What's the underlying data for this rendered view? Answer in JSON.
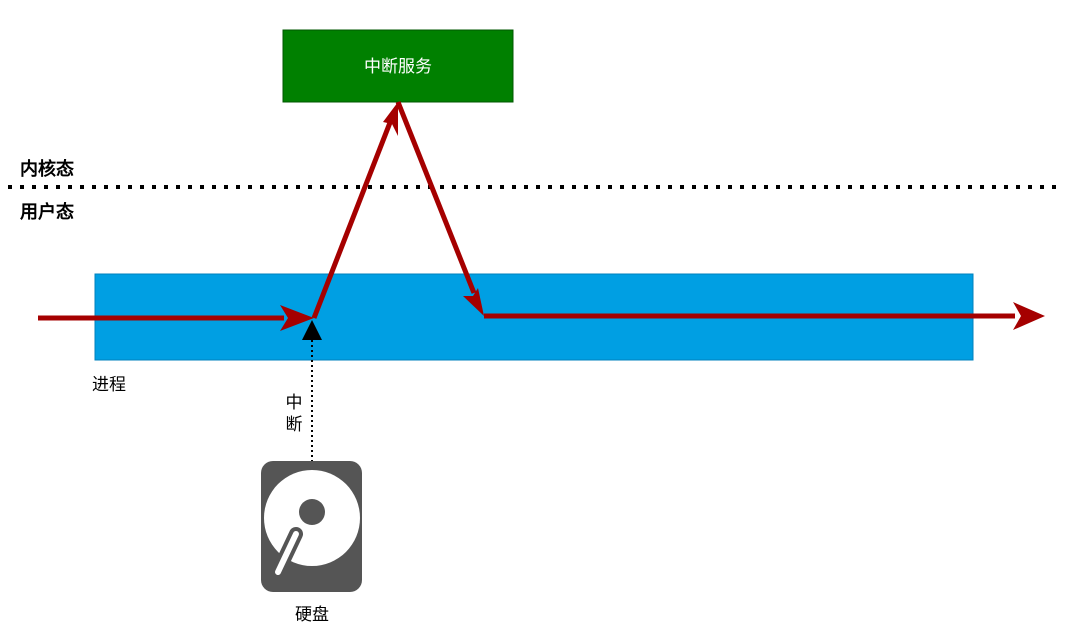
{
  "labels": {
    "kernel_mode": "内核态",
    "user_mode": "用户态",
    "interrupt_service": "中断服务",
    "process": "进程",
    "interrupt_char_1": "中",
    "interrupt_char_2": "断",
    "hard_disk": "硬盘"
  },
  "colors": {
    "process_bar": "#009FE3",
    "service_box": "#008000",
    "flow_arrow": "#A50000",
    "divider": "#000000",
    "disk_body": "#555555"
  }
}
